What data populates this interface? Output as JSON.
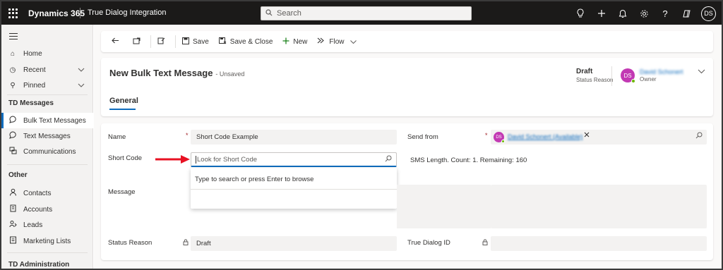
{
  "topbar": {
    "app_name": "Dynamics 365",
    "area_name": "True Dialog Integration",
    "search_placeholder": "Search",
    "user_initials": "DS",
    "icons": [
      "lightbulb-icon",
      "plus-icon",
      "bell-icon",
      "gear-icon",
      "help-icon",
      "copilot-icon"
    ]
  },
  "sidebar": {
    "top_items": [
      {
        "label": "Home",
        "icon": "home-icon"
      },
      {
        "label": "Recent",
        "icon": "clock-icon",
        "expandable": true
      },
      {
        "label": "Pinned",
        "icon": "pin-icon",
        "expandable": true
      }
    ],
    "groups": [
      {
        "title": "TD Messages",
        "items": [
          {
            "label": "Bulk Text Messages",
            "icon": "chat-icon",
            "active": true
          },
          {
            "label": "Text Messages",
            "icon": "chat-icon"
          },
          {
            "label": "Communications",
            "icon": "communications-icon"
          }
        ]
      },
      {
        "title": "Other",
        "items": [
          {
            "label": "Contacts",
            "icon": "person-icon"
          },
          {
            "label": "Accounts",
            "icon": "building-icon"
          },
          {
            "label": "Leads",
            "icon": "phone-person-icon"
          },
          {
            "label": "Marketing Lists",
            "icon": "list-icon"
          }
        ]
      },
      {
        "title": "TD Administration",
        "items": []
      }
    ]
  },
  "commandbar": {
    "save": "Save",
    "save_close": "Save & Close",
    "new": "New",
    "flow": "Flow"
  },
  "header": {
    "title": "New Bulk Text Message",
    "subtitle": "- Unsaved",
    "status_value": "Draft",
    "status_label": "Status Reason",
    "owner_initials": "DS",
    "owner_name": "David Schonert",
    "owner_label": "Owner",
    "tab": "General"
  },
  "form": {
    "name_label": "Name",
    "name_value": "Short Code Example",
    "short_code_label": "Short Code",
    "short_code_placeholder": "Look for Short Code",
    "lookup_hint": "Type to search or press Enter to browse",
    "message_label": "Message",
    "status_reason_label": "Status Reason",
    "status_reason_value": "Draft",
    "send_from_label": "Send from",
    "send_from_initials": "DS",
    "send_from_value": "David Schonert (Available)",
    "sms_info": "SMS Length. Count: 1. Remaining: 160",
    "true_dialog_id_label": "True Dialog ID",
    "true_dialog_id_value": "",
    "required_mark": "*"
  },
  "colors": {
    "topbar": "#1b1a19",
    "accent": "#0f6cbd",
    "avatar": "#c239b3",
    "presence": "#6bb700",
    "arrow": "#e81123"
  }
}
